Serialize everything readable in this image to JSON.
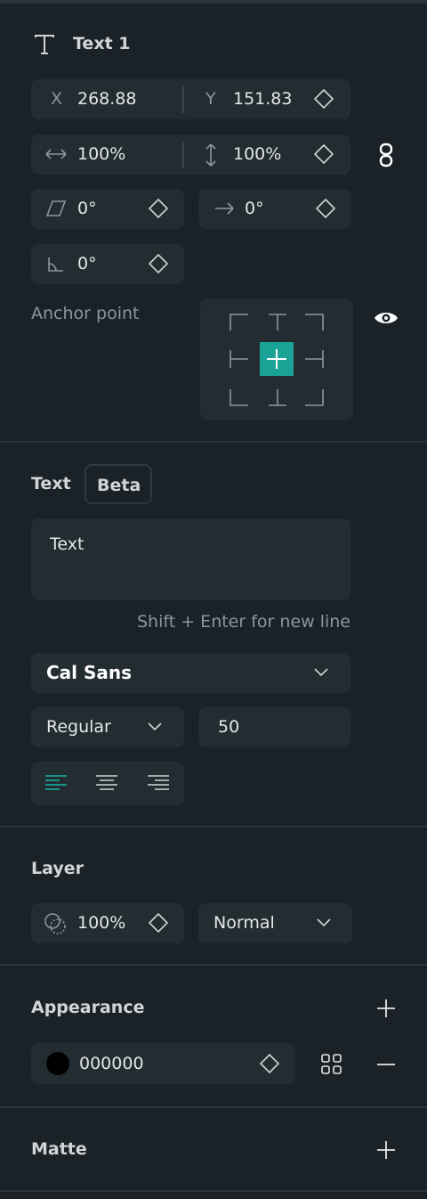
{
  "layer_header": {
    "title": "Text 1",
    "icon": "text-tool-icon"
  },
  "transform": {
    "x_label": "X",
    "x_value": "268.88",
    "y_label": "Y",
    "y_value": "151.83",
    "scale_w": "100%",
    "scale_h": "100%",
    "skew": "0°",
    "rotation": "0°",
    "skew_angle": "0°",
    "anchor_label": "Anchor point"
  },
  "text_section": {
    "title": "Text",
    "badge": "Beta",
    "content": "Text",
    "hint": "Shift + Enter for new line",
    "font_family": "Cal Sans",
    "font_weight": "Regular",
    "font_size": "50"
  },
  "layer_section": {
    "title": "Layer",
    "opacity": "100%",
    "blend_mode": "Normal"
  },
  "appearance_section": {
    "title": "Appearance",
    "fill_hex": "000000",
    "fill_color": "#000000"
  },
  "matte_section": {
    "title": "Matte"
  },
  "colors": {
    "accent": "#1aa396",
    "background": "#1b2227",
    "field": "#232c31"
  }
}
